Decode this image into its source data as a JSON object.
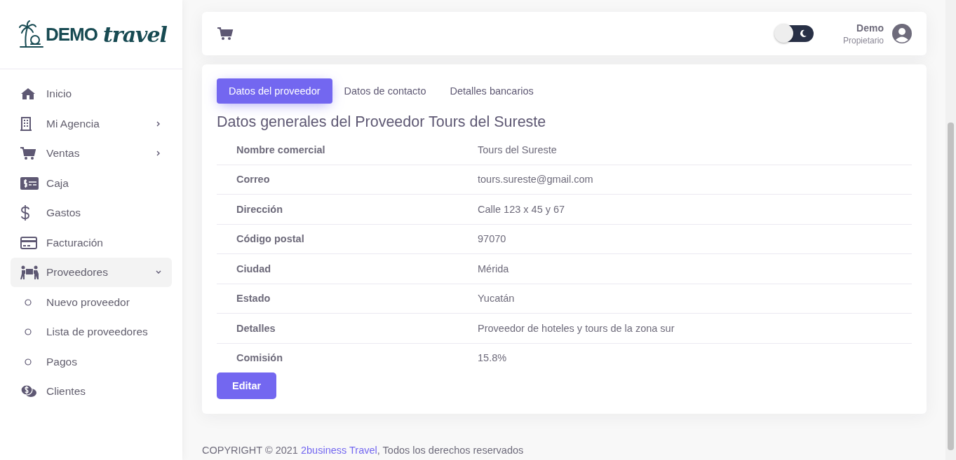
{
  "logo": {
    "bold": "DEMO",
    "script": "travel"
  },
  "sidebar": {
    "items": [
      {
        "label": "Inicio",
        "selected": false
      },
      {
        "label": "Mi Agencia",
        "expanded": false,
        "selected": false
      },
      {
        "label": "Ventas",
        "expanded": false,
        "selected": false
      },
      {
        "label": "Caja",
        "selected": false
      },
      {
        "label": "Gastos",
        "selected": false
      },
      {
        "label": "Facturación",
        "selected": false
      },
      {
        "label": "Proveedores",
        "expanded": true,
        "selected": true,
        "children": [
          {
            "label": "Nuevo proveedor"
          },
          {
            "label": "Lista de proveedores"
          },
          {
            "label": "Pagos"
          }
        ]
      },
      {
        "label": "Clientes",
        "selected": false
      }
    ]
  },
  "header": {
    "dark_mode": false,
    "user": {
      "name": "Demo",
      "role": "Propietario"
    }
  },
  "tabs": [
    {
      "label": "Datos del proveedor",
      "selected": true
    },
    {
      "label": "Datos de contacto",
      "selected": false
    },
    {
      "label": "Detalles bancarios",
      "selected": false
    }
  ],
  "section_title": "Datos generales del Proveedor Tours del Sureste",
  "details": [
    {
      "label": "Nombre comercial",
      "value": "Tours del Sureste"
    },
    {
      "label": "Correo",
      "value": "tours.sureste@gmail.com"
    },
    {
      "label": "Dirección",
      "value": "Calle 123 x 45 y 67"
    },
    {
      "label": "Código postal",
      "value": "97070"
    },
    {
      "label": "Ciudad",
      "value": "Mérida"
    },
    {
      "label": "Estado",
      "value": "Yucatán"
    },
    {
      "label": "Detalles",
      "value": "Proveedor de hoteles y tours de la zona sur"
    },
    {
      "label": "Comisión",
      "value": "15.8%"
    }
  ],
  "edit_button": "Editar",
  "footer": {
    "prefix": "COPYRIGHT © 2021 ",
    "link": "2business Travel",
    "suffix": ", Todos los derechos reservados"
  }
}
